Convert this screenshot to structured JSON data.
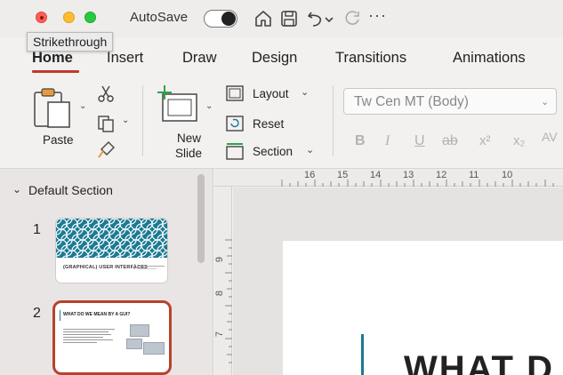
{
  "titlebar": {
    "autosave_label": "AutoSave",
    "icons": [
      "home-icon",
      "save-icon",
      "undo-icon",
      "undo-dropdown-icon",
      "redo-icon",
      "more-icon"
    ],
    "more_glyph": "···"
  },
  "tooltip": {
    "text": "Strikethrough"
  },
  "tabs": [
    {
      "label": "Home",
      "active": true
    },
    {
      "label": "Insert"
    },
    {
      "label": "Draw"
    },
    {
      "label": "Design"
    },
    {
      "label": "Transitions"
    },
    {
      "label": "Animations"
    }
  ],
  "ribbon": {
    "paste_label": "Paste",
    "new_slide_label_1": "New",
    "new_slide_label_2": "Slide",
    "layout_label": "Layout",
    "reset_label": "Reset",
    "section_label": "Section",
    "font_name": "Tw Cen MT (Body)",
    "format_buttons": [
      "B",
      "I",
      "U",
      "ab",
      "x²",
      "x₂",
      "AV"
    ]
  },
  "thumbnails": {
    "section_header": "Default Section",
    "slides": [
      {
        "number": "1",
        "title": "(GRAPHICAL) USER INTERFACES"
      },
      {
        "number": "2",
        "title": "WHAT DO WE MEAN BY A GUI?"
      }
    ]
  },
  "ruler": {
    "horizontal": [
      "16",
      "15",
      "14",
      "13",
      "12",
      "11",
      "10"
    ],
    "vertical": [
      "9",
      "8",
      "7"
    ]
  },
  "slide": {
    "title_fragment": "WHAT D"
  },
  "colors": {
    "accent": "#c0392b",
    "teal": "#1b7a94"
  }
}
